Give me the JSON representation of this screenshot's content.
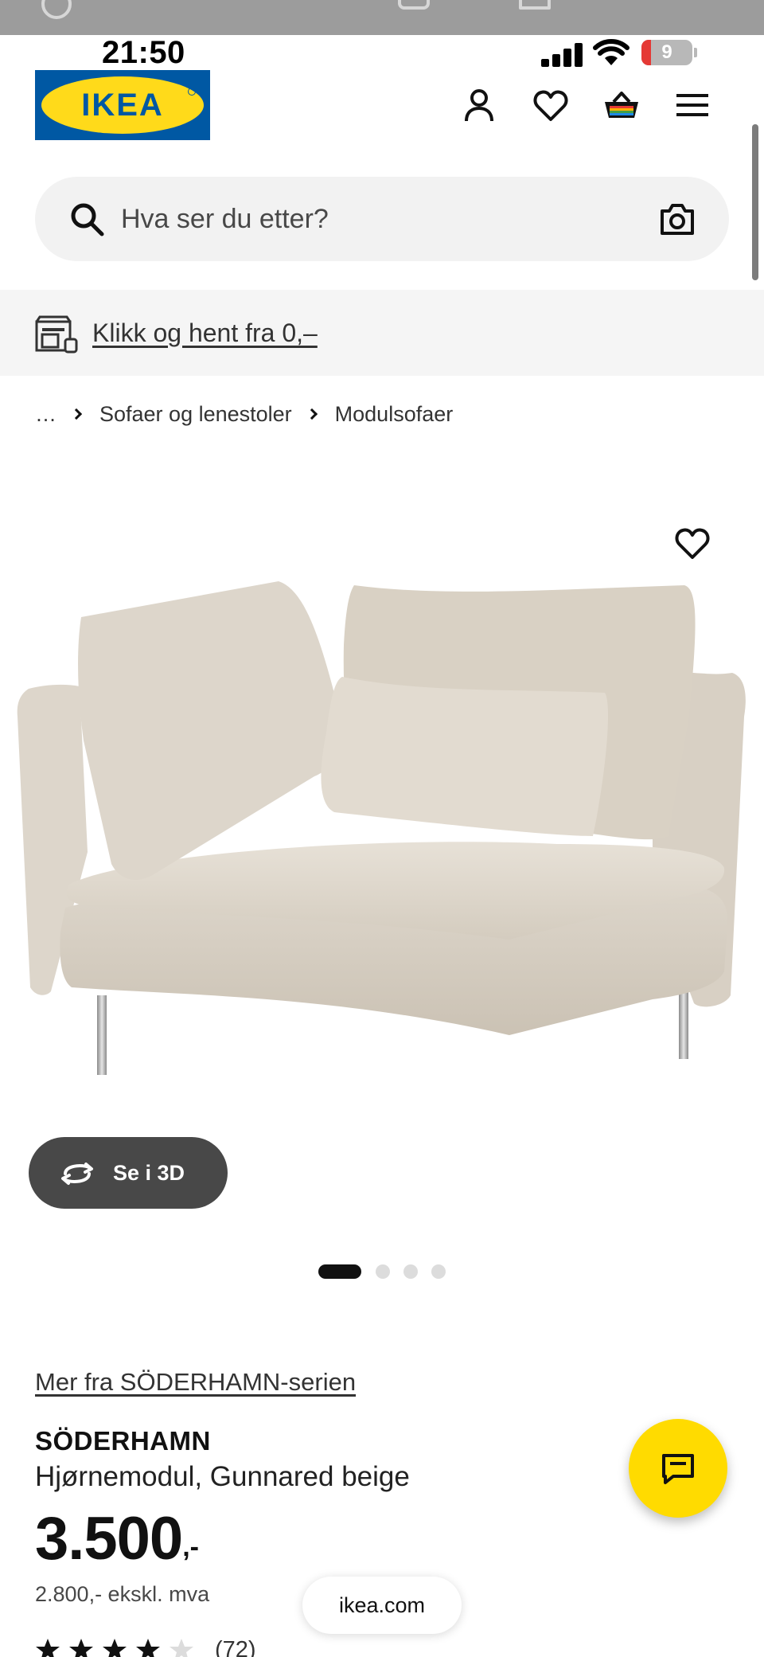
{
  "status_bar": {
    "time": "21:50",
    "battery": "9"
  },
  "brand": {
    "logo_text": "IKEA",
    "blue": "#0058a3",
    "yellow": "#ffda1a"
  },
  "header": {
    "icons": [
      "account-icon",
      "heart-icon",
      "basket-icon",
      "menu-icon"
    ]
  },
  "search": {
    "placeholder": "Hva ser du etter?",
    "camera_icon": "camera-icon"
  },
  "banner": {
    "text": "Klikk og hent fra 0,–",
    "icon": "store-pickup-icon"
  },
  "breadcrumb": {
    "items": [
      "…",
      "Sofaer og lenestoler",
      "Modulsofaer"
    ]
  },
  "gallery": {
    "view_3d_label": "Se i 3D",
    "slide_count": 4,
    "active_slide": 1
  },
  "product": {
    "series_link": "Mer fra SÖDERHAMN-serien",
    "name": "SÖDERHAMN",
    "description": "Hjørnemodul, Gunnared beige",
    "price_int": "3.500",
    "price_dec": ",-",
    "price_ex_vat": "2.800,- ekskl. mva",
    "rating": 4,
    "rating_max": 5,
    "review_count": "(72)"
  },
  "browser": {
    "url": "ikea.com"
  },
  "colors": {
    "chat_button": "#ffdb00",
    "button_dark": "#484848"
  }
}
